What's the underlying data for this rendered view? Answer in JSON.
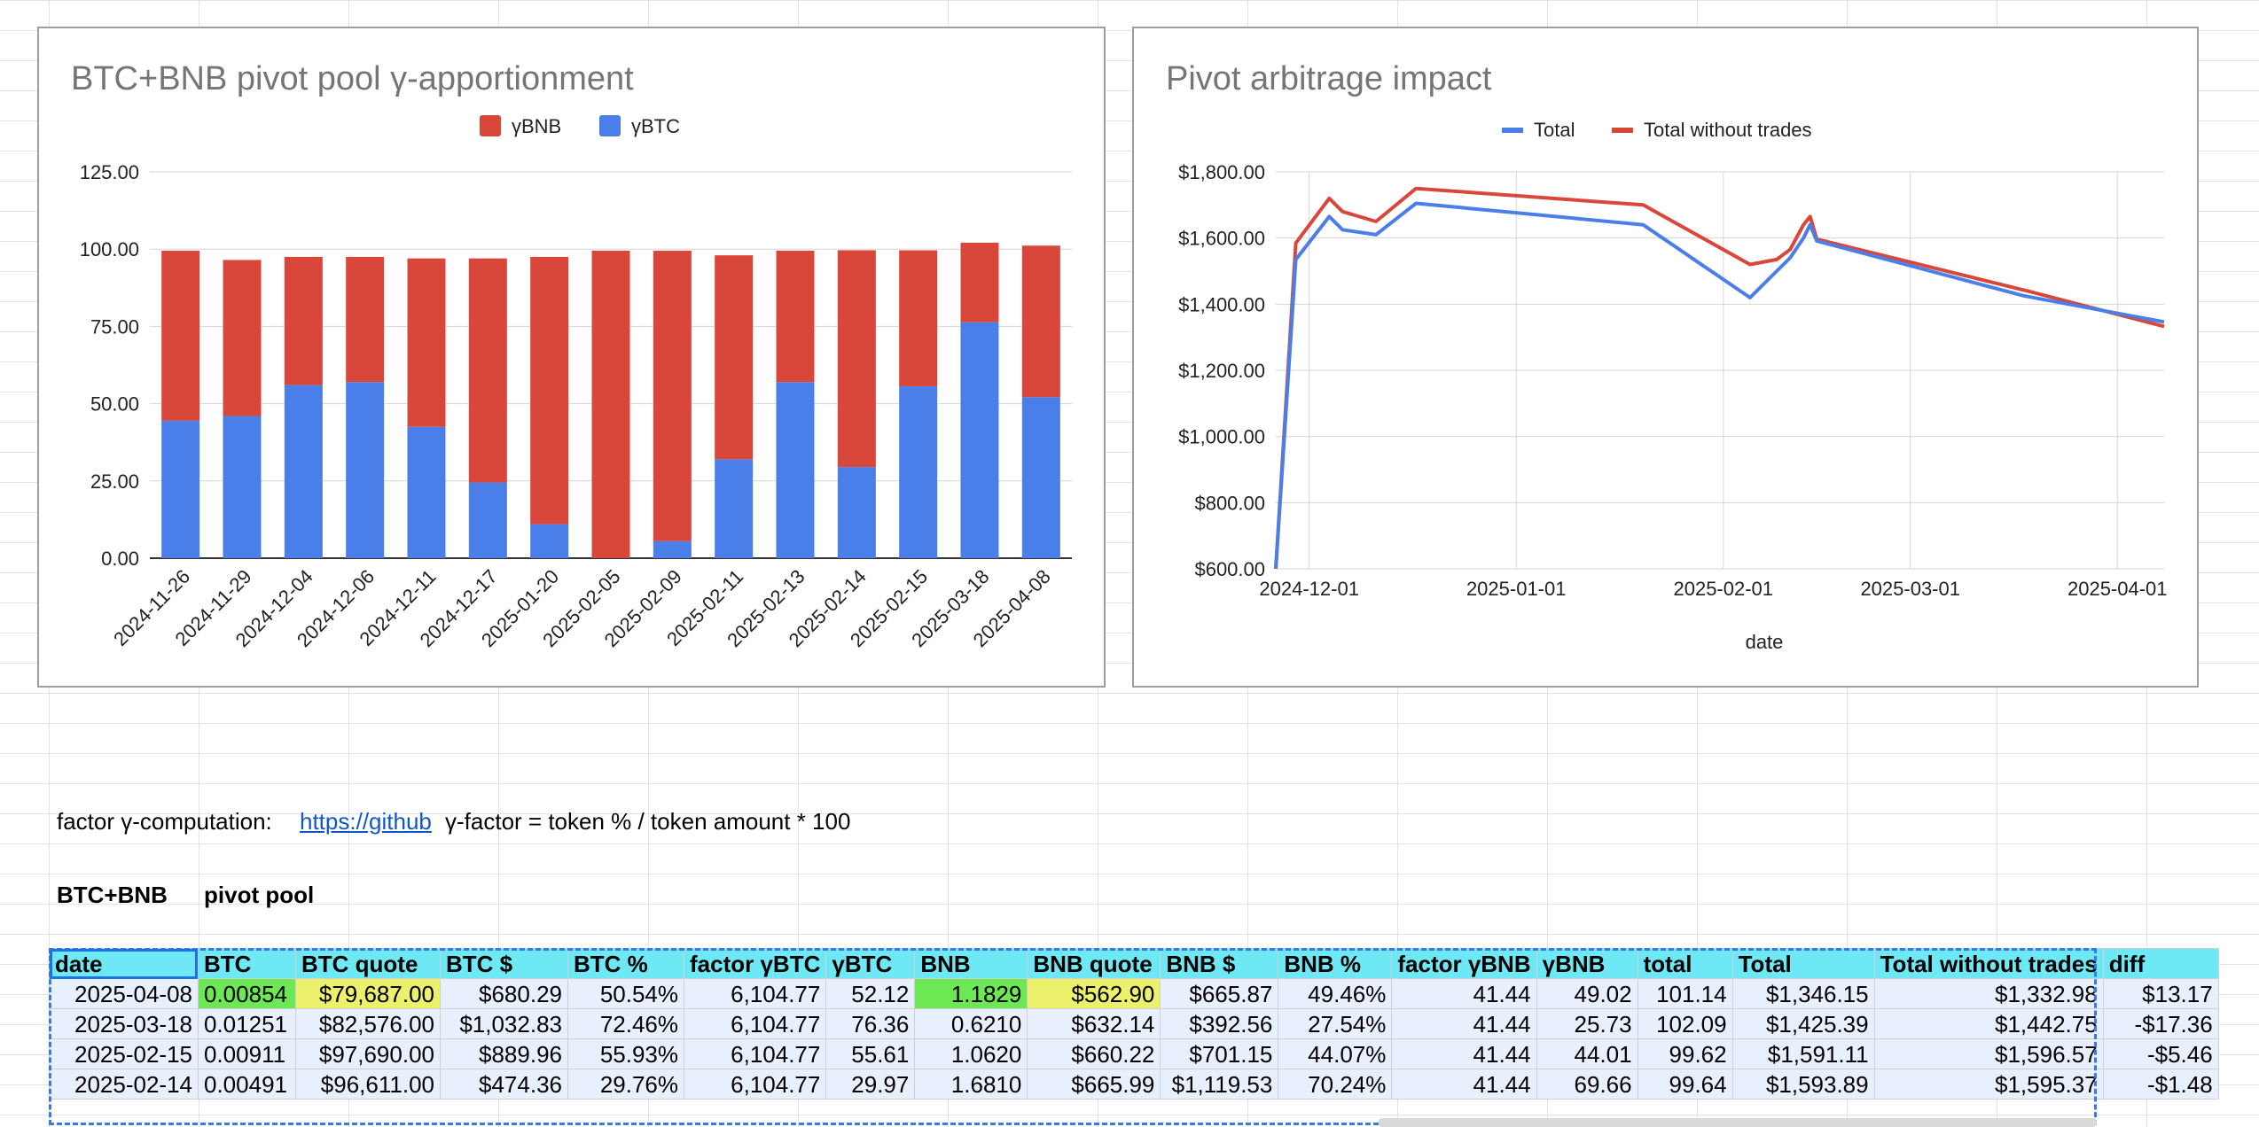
{
  "charts": [
    {
      "title": "BTC+BNB pivot pool γ-apportionment",
      "chart_data": {
        "type": "bar",
        "stacked": true,
        "legend_position": "top",
        "categories": [
          "2024-11-26",
          "2024-11-29",
          "2024-12-04",
          "2024-12-06",
          "2024-12-11",
          "2024-12-17",
          "2025-01-20",
          "2025-02-05",
          "2025-02-09",
          "2025-02-11",
          "2025-02-13",
          "2025-02-14",
          "2025-02-15",
          "2025-03-18",
          "2025-04-08"
        ],
        "series": [
          {
            "name": "γBTC",
            "color": "#4a7fe9",
            "values": [
              44.5,
              46,
              56,
              57,
              42.5,
              24.5,
              11,
              0,
              5.5,
              32,
              57,
              29.5,
              55.61,
              76.36,
              52.12
            ]
          },
          {
            "name": "γBNB",
            "color": "#d8473a",
            "values": [
              55,
              50.5,
              41.5,
              40.5,
              54.5,
              72.5,
              86.5,
              99.5,
              94,
              66,
              42.5,
              70.14,
              44.01,
              25.73,
              49.02
            ]
          }
        ],
        "yticks": [
          "0.00",
          "25.00",
          "50.00",
          "75.00",
          "100.00",
          "125.00"
        ],
        "ylim": [
          0,
          125
        ],
        "grid": true
      }
    },
    {
      "title": "Pivot arbitrage impact",
      "chart_data": {
        "type": "line",
        "legend_position": "top",
        "xlabel": "date",
        "xticks": [
          "2024-12-01",
          "2025-01-01",
          "2025-02-01",
          "2025-03-01",
          "2025-04-01"
        ],
        "yticks": [
          "$600.00",
          "$800.00",
          "$1,000.00",
          "$1,200.00",
          "$1,400.00",
          "$1,600.00",
          "$1,800.00"
        ],
        "ylim": [
          600,
          1800
        ],
        "xlim": [
          "2024-11-26",
          "2025-04-08"
        ],
        "x": [
          "2024-11-26",
          "2024-11-29",
          "2024-12-04",
          "2024-12-06",
          "2024-12-11",
          "2024-12-17",
          "2025-01-20",
          "2025-02-05",
          "2025-02-09",
          "2025-02-11",
          "2025-02-13",
          "2025-02-14",
          "2025-02-15",
          "2025-03-18",
          "2025-04-08"
        ],
        "series": [
          {
            "name": "Total",
            "color": "#4a7fe9",
            "values": [
              600,
              1535,
              1665,
              1625,
              1610,
              1705,
              1640,
              1420,
              1500,
              1540,
              1600,
              1640,
              1591.11,
              1425.39,
              1346.15
            ]
          },
          {
            "name": "Total without trades",
            "color": "#d8473a",
            "values": [
              600,
              1585,
              1720,
              1680,
              1650,
              1750,
              1700,
              1520,
              1535,
              1565,
              1640,
              1665,
              1596.57,
              1442.75,
              1332.98
            ]
          }
        ],
        "grid": true
      }
    }
  ],
  "sheet": {
    "factor_label": "factor γ-computation:",
    "link_text": "https://github",
    "formula_text": "γ-factor = token % / token amount * 100",
    "pool_name": "BTC+BNB",
    "pool_label": "pivot pool",
    "headers": [
      "date",
      "BTC",
      "BTC quote",
      "BTC $",
      "BTC %",
      "factor γBTC",
      "γBTC",
      "BNB",
      "BNB quote",
      "BNB $",
      "BNB %",
      "factor γBNB",
      "γBNB",
      "total",
      "Total",
      "Total without trades",
      "diff"
    ],
    "rows": [
      [
        "2025-04-08",
        "0.00854",
        "$79,687.00",
        "$680.29",
        "50.54%",
        "6,104.77",
        "52.12",
        "1.1829",
        "$562.90",
        "$665.87",
        "49.46%",
        "41.44",
        "49.02",
        "101.14",
        "$1,346.15",
        "$1,332.98",
        "$13.17"
      ],
      [
        "2025-03-18",
        "0.01251",
        "$82,576.00",
        "$1,032.83",
        "72.46%",
        "6,104.77",
        "76.36",
        "0.6210",
        "$632.14",
        "$392.56",
        "27.54%",
        "41.44",
        "25.73",
        "102.09",
        "$1,425.39",
        "$1,442.75",
        "-$17.36"
      ],
      [
        "2025-02-15",
        "0.00911",
        "$97,690.00",
        "$889.96",
        "55.93%",
        "6,104.77",
        "55.61",
        "1.0620",
        "$660.22",
        "$701.15",
        "44.07%",
        "41.44",
        "44.01",
        "99.62",
        "$1,591.11",
        "$1,596.57",
        "-$5.46"
      ],
      [
        "2025-02-14",
        "0.00491",
        "$96,611.00",
        "$474.36",
        "29.76%",
        "6,104.77",
        "29.97",
        "1.6810",
        "$665.99",
        "$1,119.53",
        "70.24%",
        "41.44",
        "69.66",
        "99.64",
        "$1,593.89",
        "$1,595.37",
        "-$1.48"
      ]
    ]
  }
}
